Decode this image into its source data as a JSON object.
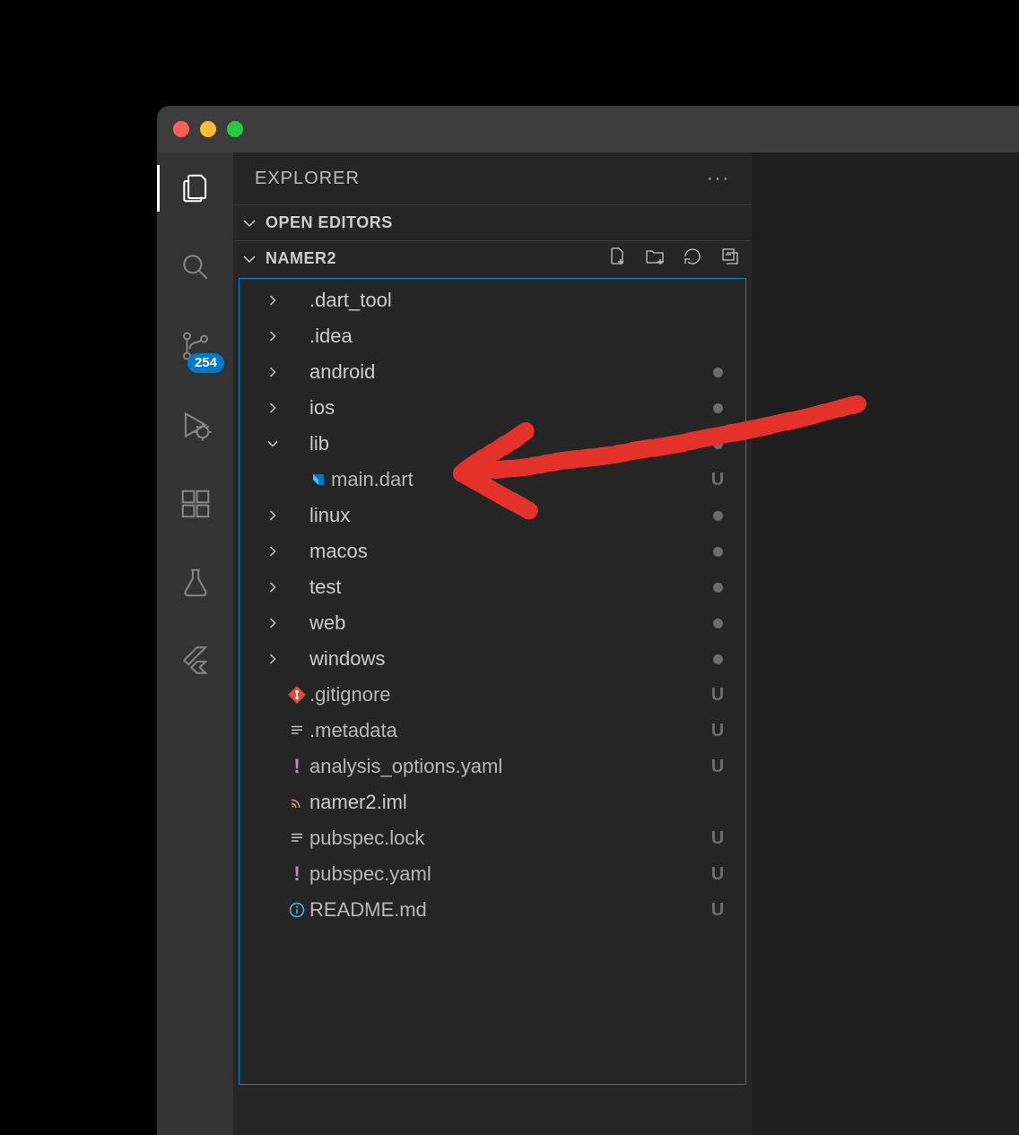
{
  "sidebar": {
    "title": "EXPLORER",
    "sections": {
      "openEditors": {
        "label": "OPEN EDITORS"
      },
      "folder": {
        "label": "NAMER2"
      }
    }
  },
  "activitybar": {
    "scm_badge": "254"
  },
  "tree": [
    {
      "kind": "folder",
      "name": ".dart_tool",
      "depth": 1,
      "expanded": false,
      "status": null
    },
    {
      "kind": "folder",
      "name": ".idea",
      "depth": 1,
      "expanded": false,
      "status": null
    },
    {
      "kind": "folder",
      "name": "android",
      "depth": 1,
      "expanded": false,
      "status": "dot"
    },
    {
      "kind": "folder",
      "name": "ios",
      "depth": 1,
      "expanded": false,
      "status": "dot"
    },
    {
      "kind": "folder",
      "name": "lib",
      "depth": 1,
      "expanded": true,
      "status": "dot"
    },
    {
      "kind": "file",
      "name": "main.dart",
      "depth": 2,
      "icon": "dart",
      "status": "U"
    },
    {
      "kind": "folder",
      "name": "linux",
      "depth": 1,
      "expanded": false,
      "status": "dot"
    },
    {
      "kind": "folder",
      "name": "macos",
      "depth": 1,
      "expanded": false,
      "status": "dot"
    },
    {
      "kind": "folder",
      "name": "test",
      "depth": 1,
      "expanded": false,
      "status": "dot"
    },
    {
      "kind": "folder",
      "name": "web",
      "depth": 1,
      "expanded": false,
      "status": "dot"
    },
    {
      "kind": "folder",
      "name": "windows",
      "depth": 1,
      "expanded": false,
      "status": "dot"
    },
    {
      "kind": "file",
      "name": ".gitignore",
      "depth": 1,
      "icon": "git",
      "status": "U"
    },
    {
      "kind": "file",
      "name": ".metadata",
      "depth": 1,
      "icon": "lines",
      "status": "U"
    },
    {
      "kind": "file",
      "name": "analysis_options.yaml",
      "depth": 1,
      "icon": "excl",
      "status": "U"
    },
    {
      "kind": "file",
      "name": "namer2.iml",
      "depth": 1,
      "icon": "feed",
      "status": null
    },
    {
      "kind": "file",
      "name": "pubspec.lock",
      "depth": 1,
      "icon": "lines",
      "status": "U"
    },
    {
      "kind": "file",
      "name": "pubspec.yaml",
      "depth": 1,
      "icon": "excl",
      "status": "U"
    },
    {
      "kind": "file",
      "name": "README.md",
      "depth": 1,
      "icon": "info",
      "status": "U"
    }
  ]
}
